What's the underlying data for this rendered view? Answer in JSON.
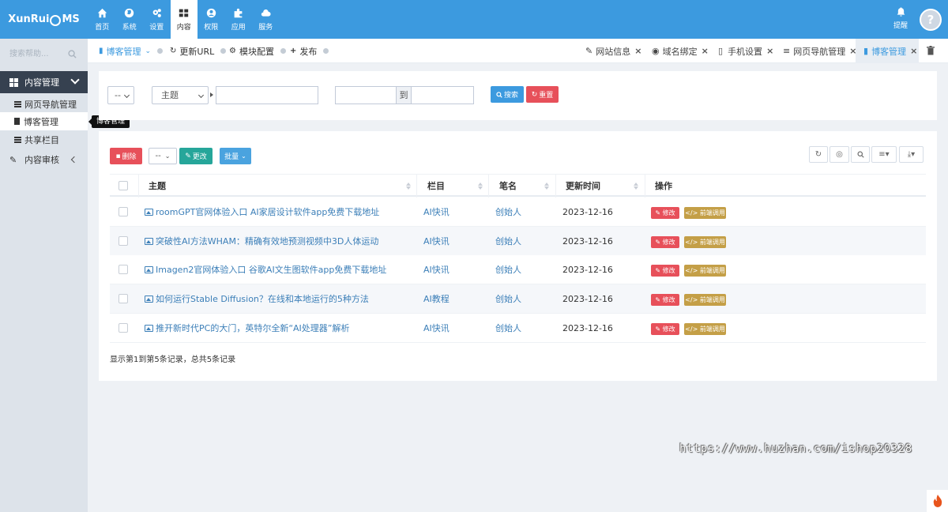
{
  "header": {
    "logo": {
      "pre": "XunRui",
      "post": "MS"
    },
    "nav": [
      {
        "label": "首页",
        "icon": "home-icon"
      },
      {
        "label": "系统",
        "icon": "globe-icon"
      },
      {
        "label": "设置",
        "icon": "cogs-icon"
      },
      {
        "label": "内容",
        "icon": "grid-icon",
        "active": true
      },
      {
        "label": "权限",
        "icon": "user-circle-icon"
      },
      {
        "label": "应用",
        "icon": "puzzle-icon"
      },
      {
        "label": "服务",
        "icon": "cloud-icon"
      }
    ],
    "remind_label": "提醒"
  },
  "sidebar": {
    "search_placeholder": "搜索帮助...",
    "menu_head": "内容管理",
    "items": [
      "网页导航管理",
      "博客管理",
      "共享栏目"
    ],
    "audit": "内容审核",
    "tooltip": "博客管理"
  },
  "tabbar": {
    "crumbs": [
      "博客管理",
      "更新URL",
      "模块配置",
      "发布"
    ],
    "tabs": [
      "网站信息",
      "域名绑定",
      "手机设置",
      "网页导航管理",
      "博客管理"
    ]
  },
  "search_panel": {
    "select_any": "-- ",
    "field_select": "主题",
    "to_label": "到",
    "search_btn": "搜索",
    "reset_btn": "重置"
  },
  "toolbar": {
    "delete_btn": "删除",
    "select_any": "--",
    "change_btn": "更改",
    "batch_btn": "批量"
  },
  "table": {
    "headers": [
      "主题",
      "栏目",
      "笔名",
      "更新时间",
      "操作"
    ],
    "edit_label": "修改",
    "front_label": "前端调用",
    "rows": [
      {
        "title": "roomGPT官网体验入口 AI家居设计软件app免费下载地址",
        "category": "AI快讯",
        "author": "创始人",
        "date": "2023-12-16"
      },
      {
        "title": "突破性AI方法WHAM：精确有效地预测视频中3D人体运动",
        "category": "AI快讯",
        "author": "创始人",
        "date": "2023-12-16"
      },
      {
        "title": "Imagen2官网体验入口 谷歌AI文生图软件app免费下载地址",
        "category": "AI快讯",
        "author": "创始人",
        "date": "2023-12-16"
      },
      {
        "title": "如何运行Stable Diffusion？在线和本地运行的5种方法",
        "category": "AI教程",
        "author": "创始人",
        "date": "2023-12-16"
      },
      {
        "title": "推开新时代PC的大门，英特尔全新“AI处理器”解析",
        "category": "AI快讯",
        "author": "创始人",
        "date": "2023-12-16"
      }
    ],
    "summary": "显示第1到第5条记录，总共5条记录"
  },
  "watermark": "https://www.huzhan.com/ishop20328",
  "colors": {
    "primary": "#3c9adf",
    "danger": "#e7505a",
    "success": "#26a69a",
    "warning": "#c49f47",
    "sidebar_active": "#364150"
  }
}
